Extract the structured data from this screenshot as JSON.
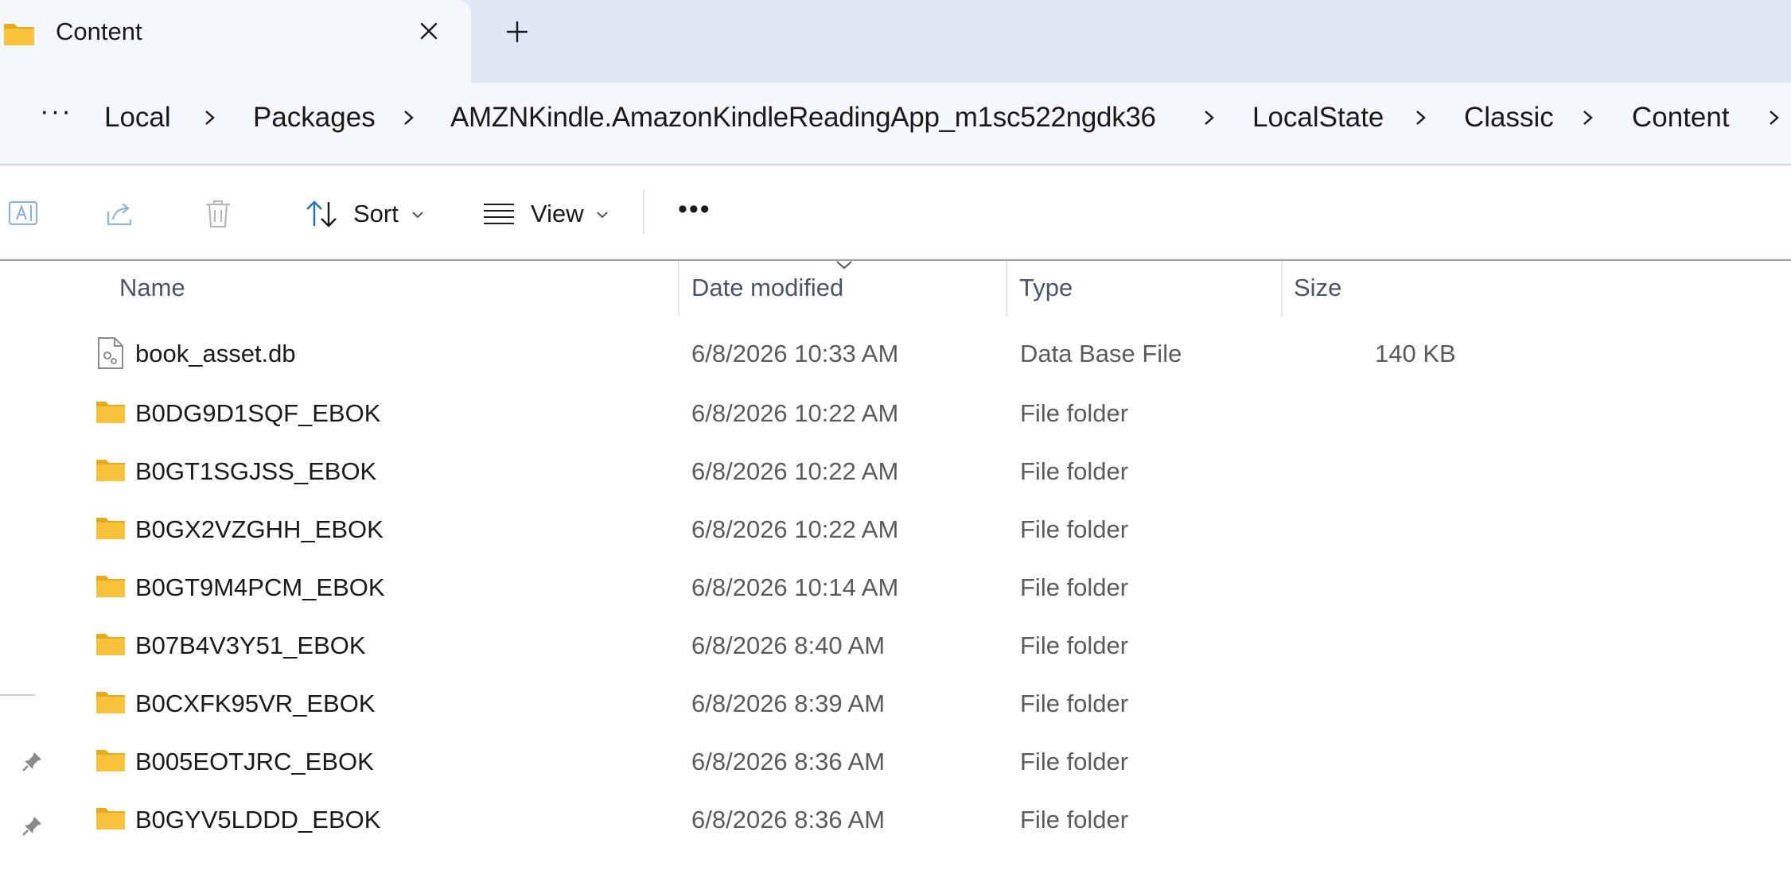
{
  "tab": {
    "title": "Content",
    "close_label": "Close tab",
    "new_tab_label": "New tab"
  },
  "address": {
    "overflow": "···",
    "crumbs": [
      "Local",
      "Packages",
      "AMZNKindle.AmazonKindleReadingApp_m1sc522ngdk36",
      "LocalState",
      "Classic",
      "Content"
    ]
  },
  "toolbar": {
    "sort_label": "Sort",
    "view_label": "View",
    "more_label": "•••"
  },
  "columns": {
    "name": "Name",
    "date": "Date modified",
    "type": "Type",
    "size": "Size"
  },
  "rows": [
    {
      "name": "book_asset.db",
      "date": "6/8/2026 10:33 AM",
      "type": "Data Base File",
      "size": "140 KB",
      "icon": "file-icon"
    },
    {
      "name": "B0DG9D1SQF_EBOK",
      "date": "6/8/2026 10:22 AM",
      "type": "File folder",
      "size": "",
      "icon": "folder-icon"
    },
    {
      "name": "B0GT1SGJSS_EBOK",
      "date": "6/8/2026 10:22 AM",
      "type": "File folder",
      "size": "",
      "icon": "folder-icon"
    },
    {
      "name": "B0GX2VZGHH_EBOK",
      "date": "6/8/2026 10:22 AM",
      "type": "File folder",
      "size": "",
      "icon": "folder-icon"
    },
    {
      "name": "B0GT9M4PCM_EBOK",
      "date": "6/8/2026 10:14 AM",
      "type": "File folder",
      "size": "",
      "icon": "folder-icon"
    },
    {
      "name": "B07B4V3Y51_EBOK",
      "date": "6/8/2026 8:40 AM",
      "type": "File folder",
      "size": "",
      "icon": "folder-icon"
    },
    {
      "name": "B0CXFK95VR_EBOK",
      "date": "6/8/2026 8:39 AM",
      "type": "File folder",
      "size": "",
      "icon": "folder-icon"
    },
    {
      "name": "B005EOTJRC_EBOK",
      "date": "6/8/2026 8:36 AM",
      "type": "File folder",
      "size": "",
      "icon": "folder-icon"
    },
    {
      "name": "B0GYV5LDDD_EBOK",
      "date": "6/8/2026 8:36 AM",
      "type": "File folder",
      "size": "",
      "icon": "folder-icon"
    }
  ],
  "colors": {
    "folder": "#f8c33a",
    "folder_dark": "#e9a91c",
    "tabstrip": "#dfe9f5",
    "addressbar": "#f4f7fb",
    "accent": "#1e6fc5"
  }
}
